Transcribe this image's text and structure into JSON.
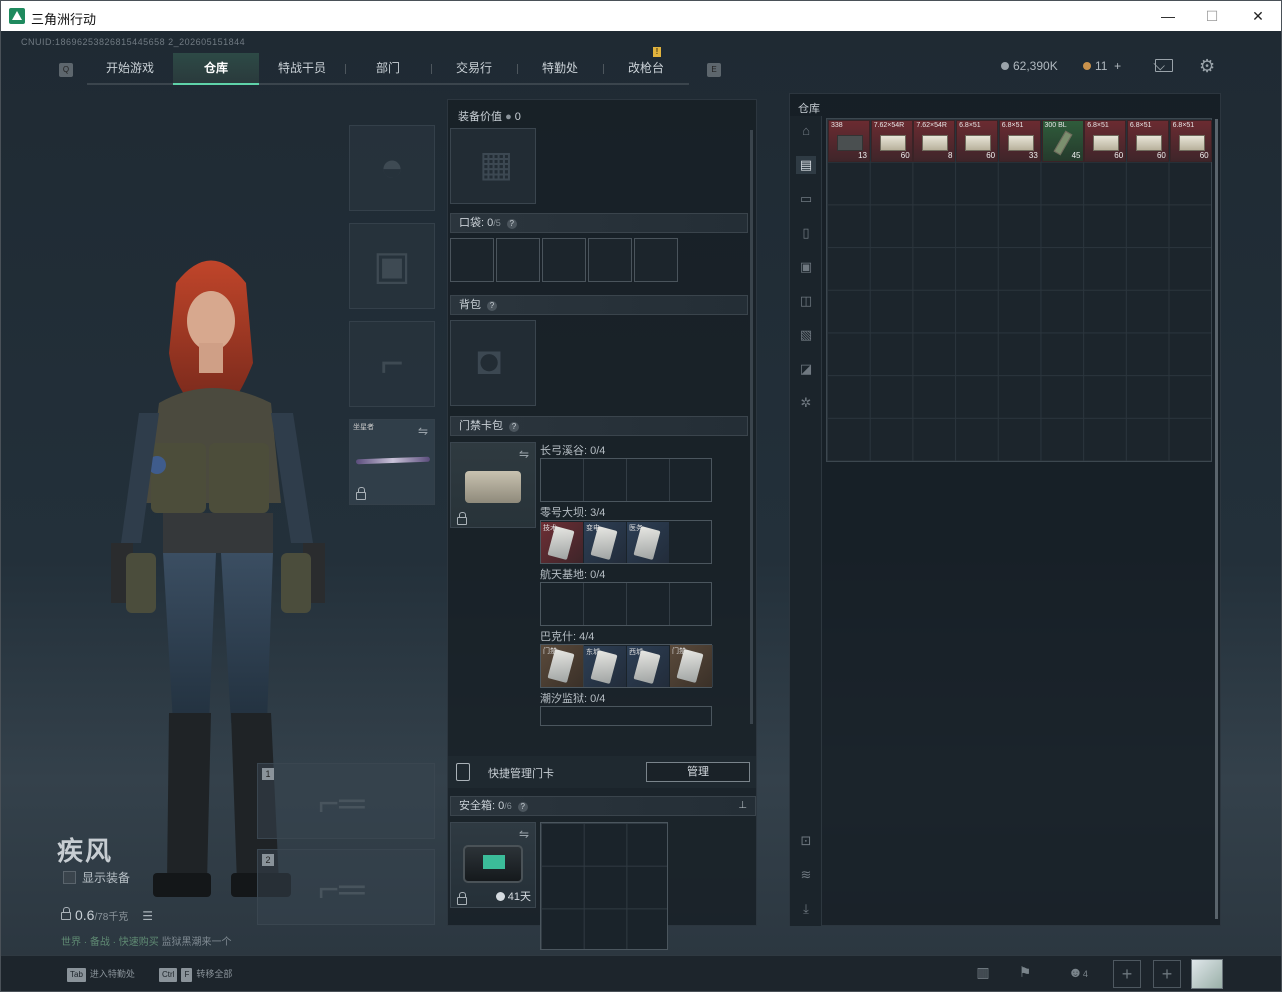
{
  "window": {
    "title": "三角洲行动",
    "min": "—",
    "max": "☐",
    "close": "✕"
  },
  "uid": "CNUID:18696253826815445658 2_202605151844",
  "nav": {
    "left_icon": "Q",
    "right_icon": "E",
    "tabs": [
      "开始游戏",
      "仓库",
      "特战干员",
      "部门",
      "交易行",
      "特勤处",
      "改枪台"
    ],
    "active": "仓库",
    "notif": "!"
  },
  "currency": {
    "money": "62,390K",
    "coins": "11",
    "plus": "+"
  },
  "character": {
    "name": "疾风",
    "show_equipment": "显示装备",
    "weight": "0.6",
    "weight_max": "/78千克",
    "hint_tag": "世界 · 备战 · 快速购买",
    "hint_text": "监狱黑潮来一个"
  },
  "slots": {
    "melee_label": "坐星者",
    "gun1": "1",
    "gun2": "2"
  },
  "mid": {
    "equip_value_label": "装备价值",
    "equip_value": "0",
    "pocket_label": "口袋:",
    "pocket_count": "0",
    "pocket_max": "/5",
    "backpack_label": "背包",
    "keycard_label": "门禁卡包",
    "keycards": [
      {
        "label": "长弓溪谷: 0/4"
      },
      {
        "label": "零号大坝: 3/4"
      },
      {
        "label": "航天基地: 0/4"
      },
      {
        "label": "巴克什: 4/4"
      },
      {
        "label": "潮汐监狱: 0/4"
      }
    ],
    "quick_manage_label": "快捷管理门卡",
    "manage_button": "管理",
    "safebox_label": "安全箱:",
    "safebox_count": "0",
    "safebox_max": "/6",
    "safebox_days": "41天"
  },
  "warehouse": {
    "title": "仓库",
    "items": [
      {
        "top": "338",
        "bot": "13",
        "style": "dk"
      },
      {
        "top": "7.62×54R",
        "bot": "60",
        "style": ""
      },
      {
        "top": "7.62×54R",
        "bot": "8",
        "style": ""
      },
      {
        "top": "6.8×51",
        "bot": "60",
        "style": ""
      },
      {
        "top": "6.8×51",
        "bot": "33",
        "style": ""
      },
      {
        "top": "300 BL",
        "bot": "45",
        "style": "g"
      },
      {
        "top": "6.8×51",
        "bot": "60",
        "style": ""
      },
      {
        "top": "6.8×51",
        "bot": "60",
        "style": ""
      },
      {
        "top": "6.8×51",
        "bot": "60",
        "style": ""
      }
    ]
  },
  "bottom": {
    "tab_key": "Tab",
    "tab_hint": "进入特勤处",
    "ctrl_key": "Ctrl",
    "f_key": "F",
    "f_hint": "转移全部",
    "squad_count": "4",
    "plus1": "+",
    "plus2": "+"
  }
}
